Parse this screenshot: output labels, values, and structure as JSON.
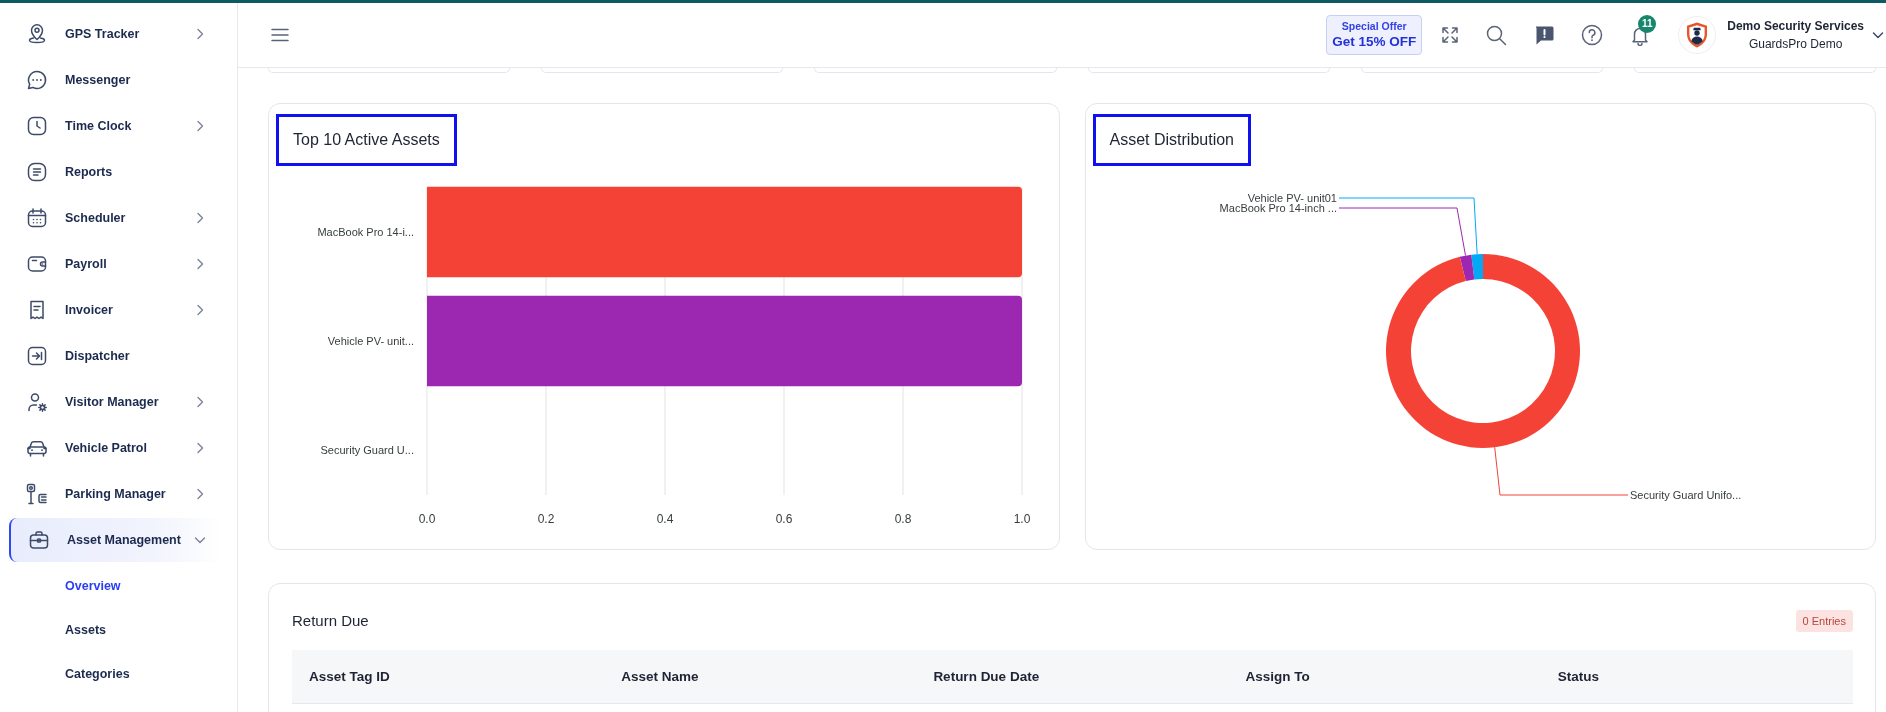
{
  "sidebar": {
    "items": [
      {
        "label": "GPS Tracker",
        "kind": "group",
        "expanded": false,
        "selected": false
      },
      {
        "label": "Messenger",
        "kind": "link",
        "selected": false
      },
      {
        "label": "Time Clock",
        "kind": "group",
        "expanded": false,
        "selected": false
      },
      {
        "label": "Reports",
        "kind": "link",
        "selected": false
      },
      {
        "label": "Scheduler",
        "kind": "group",
        "expanded": false,
        "selected": false
      },
      {
        "label": "Payroll",
        "kind": "group",
        "expanded": false,
        "selected": false
      },
      {
        "label": "Invoicer",
        "kind": "group",
        "expanded": false,
        "selected": false
      },
      {
        "label": "Dispatcher",
        "kind": "link",
        "selected": false
      },
      {
        "label": "Visitor Manager",
        "kind": "group",
        "expanded": false,
        "selected": false
      },
      {
        "label": "Vehicle Patrol",
        "kind": "group",
        "expanded": false,
        "selected": false
      },
      {
        "label": "Parking Manager",
        "kind": "group",
        "expanded": false,
        "selected": false
      },
      {
        "label": "Asset Management",
        "kind": "group",
        "expanded": true,
        "selected": true,
        "children": [
          {
            "label": "Overview",
            "selected": true
          },
          {
            "label": "Assets",
            "selected": false
          },
          {
            "label": "Categories",
            "selected": false
          }
        ]
      }
    ]
  },
  "topbar": {
    "offer": {
      "title": "Special Offer",
      "deal": "Get 15% OFF"
    },
    "notifications": {
      "count": "11"
    },
    "user": {
      "name": "Demo Security Services",
      "account": "GuardsPro Demo"
    }
  },
  "top_assets": {
    "title": "Top 10 Active Assets",
    "highlighted": true,
    "chart_data": {
      "type": "bar",
      "orientation": "horizontal",
      "grid": true,
      "categories": [
        "MacBook Pro 14-i...",
        "Vehicle PV- unit...",
        "Security Guard U..."
      ],
      "values": [
        1,
        1,
        0
      ],
      "xlim": [
        0,
        1
      ],
      "xticks": [
        {
          "value": 0,
          "label": "0.0"
        },
        {
          "value": 0.2,
          "label": "0.2"
        },
        {
          "value": 0.4,
          "label": "0.4"
        },
        {
          "value": 0.6,
          "label": "0.6"
        },
        {
          "value": 0.8,
          "label": "0.8"
        },
        {
          "value": 1,
          "label": "1.0"
        }
      ]
    }
  },
  "asset_distribution": {
    "title": "Asset Distribution",
    "highlighted": true,
    "slices": [
      {
        "label": "Vehicle PV- unit01",
        "color": "#03a9f4"
      },
      {
        "label": "MacBook Pro 14-inch ...",
        "color": "#9c27b0"
      },
      {
        "label": "Security Guard Unifo...",
        "color": "#f44336"
      }
    ]
  },
  "return_due": {
    "title": "Return Due",
    "entries": "0 Entries",
    "table": {
      "columns": [
        "Asset Tag ID",
        "Asset Name",
        "Return Due Date",
        "Assign To",
        "Status"
      ]
    }
  }
}
